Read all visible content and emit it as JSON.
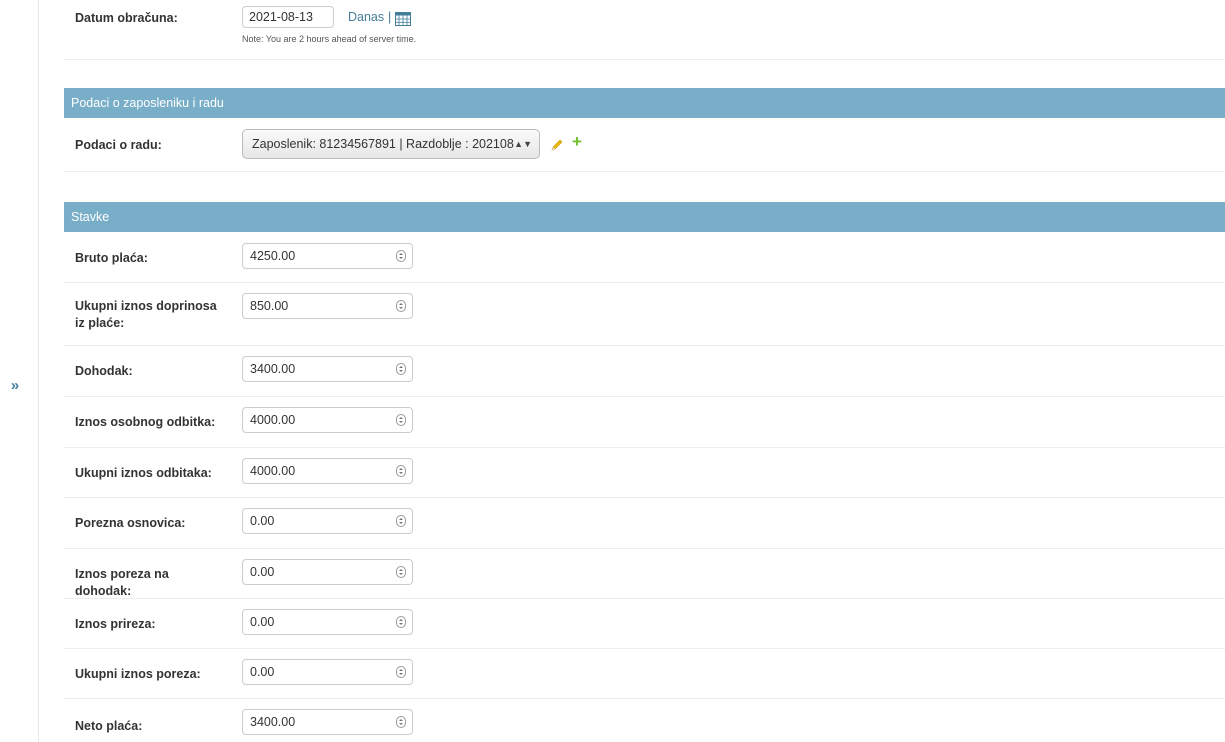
{
  "sidebar": {
    "toggle_label": "»"
  },
  "date_row": {
    "label": "Datum obračuna:",
    "value": "2021-08-13",
    "today_link": "Danas",
    "separator": "|",
    "calendar_icon": "calendar-icon",
    "note": "Note: You are 2 hours ahead of server time."
  },
  "section_employee": {
    "title": "Podaci o zaposleniku i radu",
    "label": "Podaci o radu:",
    "selected": "Zaposlenik: 81234567891 | Razdoblje : 202108",
    "arrows": "▲▼",
    "edit_icon": "pencil-icon",
    "add_label": "+"
  },
  "section_items": {
    "title": "Stavke",
    "fields": [
      {
        "label": "Bruto plaća:",
        "value": "4250.00"
      },
      {
        "label": "Ukupni iznos doprinosa iz plaće:",
        "value": "850.00"
      },
      {
        "label": "Dohodak:",
        "value": "3400.00"
      },
      {
        "label": "Iznos osobnog odbitka:",
        "value": "4000.00"
      },
      {
        "label": "Ukupni iznos odbitaka:",
        "value": "4000.00"
      },
      {
        "label": "Porezna osnovica:",
        "value": "0.00"
      },
      {
        "label": "Iznos poreza na dohodak:",
        "value": "0.00"
      },
      {
        "label": "Iznos prireza:",
        "value": "0.00"
      },
      {
        "label": "Ukupni iznos poreza:",
        "value": "0.00"
      },
      {
        "label": "Neto plaća:",
        "value": "3400.00"
      }
    ]
  },
  "colors": {
    "header_bg": "#79aec8",
    "link": "#447e9b",
    "add": "#70bf2b"
  }
}
